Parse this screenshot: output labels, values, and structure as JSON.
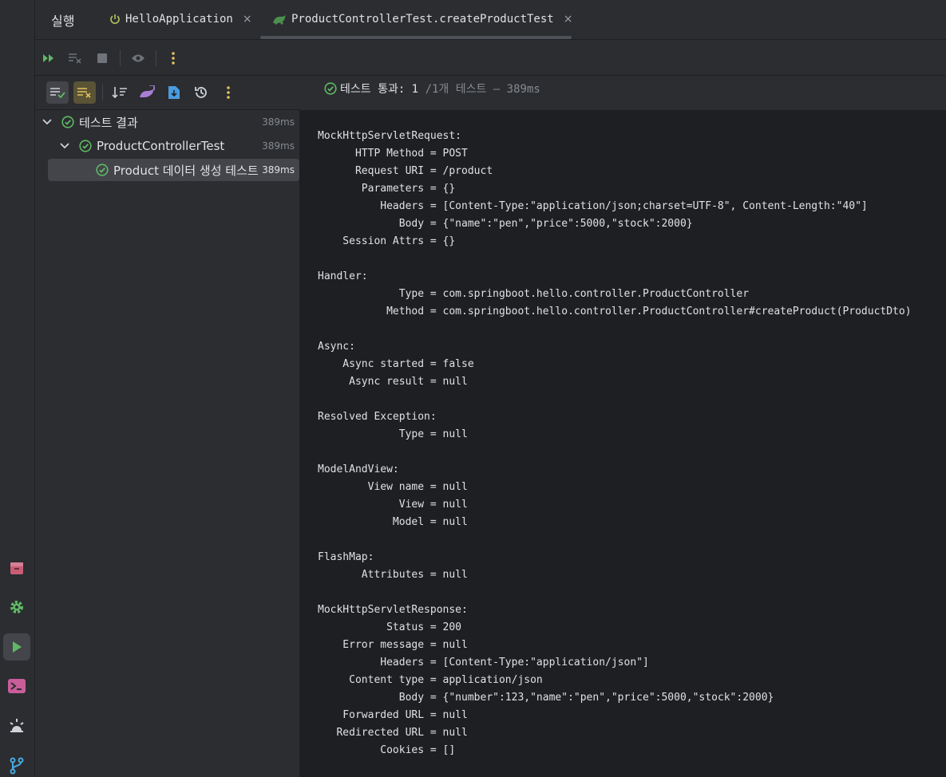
{
  "window": {
    "run_title": "실행",
    "tabs": [
      {
        "label": "HelloApplication"
      },
      {
        "label": "ProductControllerTest.createProductTest"
      }
    ],
    "close_glyph": "×"
  },
  "status": {
    "main": "테스트 통과: 1",
    "detail": "/1개 테스트 – 389ms"
  },
  "tree": {
    "root": {
      "label": "테스트 결과",
      "duration": "389ms"
    },
    "class": {
      "label": "ProductControllerTest",
      "duration": "389ms"
    },
    "method": {
      "label": "Product 데이터 생성 테스트",
      "duration": "389ms"
    }
  },
  "console_lines": [
    "MockHttpServletRequest:",
    "      HTTP Method = POST",
    "      Request URI = /product",
    "       Parameters = {}",
    "          Headers = [Content-Type:\"application/json;charset=UTF-8\", Content-Length:\"40\"]",
    "             Body = {\"name\":\"pen\",\"price\":5000,\"stock\":2000}",
    "    Session Attrs = {}",
    "",
    "Handler:",
    "             Type = com.springboot.hello.controller.ProductController",
    "           Method = com.springboot.hello.controller.ProductController#createProduct(ProductDto)",
    "",
    "Async:",
    "    Async started = false",
    "     Async result = null",
    "",
    "Resolved Exception:",
    "             Type = null",
    "",
    "ModelAndView:",
    "        View name = null",
    "             View = null",
    "            Model = null",
    "",
    "FlashMap:",
    "       Attributes = null",
    "",
    "MockHttpServletResponse:",
    "           Status = 200",
    "    Error message = null",
    "          Headers = [Content-Type:\"application/json\"]",
    "     Content type = application/json",
    "             Body = {\"number\":123,\"name\":\"pen\",\"price\":5000,\"stock\":2000}",
    "    Forwarded URL = null",
    "   Redirected URL = null",
    "          Cookies = []"
  ],
  "colors": {
    "success": "#5fb865",
    "accent_yellow": "#e0c25b",
    "run_green": "#5fb865"
  },
  "icons": {
    "sidebar": [
      "archive-icon",
      "settings-icon",
      "run-icon",
      "terminal-icon",
      "problems-icon",
      "git-icon"
    ],
    "toolbar": [
      "rerun-icon",
      "rerun-failed-icon",
      "stop-icon",
      "eye-icon",
      "more-icon"
    ],
    "toolbar2": [
      "show-passed-icon",
      "show-ignored-icon",
      "sort-icon",
      "import-tests-icon",
      "export-tests-icon",
      "history-icon",
      "more-icon"
    ]
  }
}
